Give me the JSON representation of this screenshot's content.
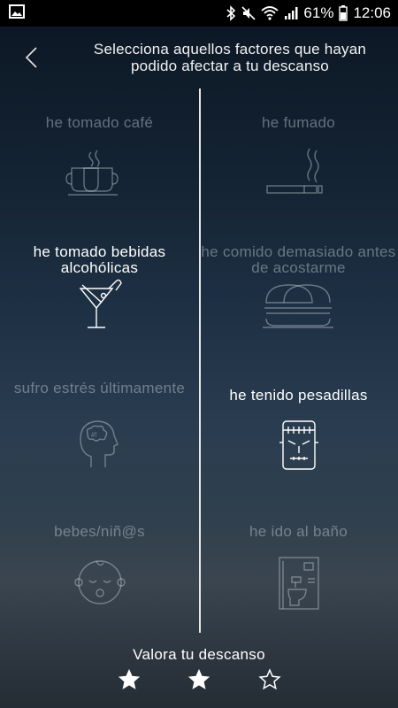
{
  "status_bar": {
    "battery": "61%",
    "time": "12:06",
    "icons": [
      "image-icon",
      "bluetooth-icon",
      "mute-icon",
      "wifi-icon",
      "signal-icon",
      "battery-icon"
    ]
  },
  "header": {
    "title": "Selecciona aquellos factores que hayan podido afectar a tu descanso"
  },
  "factors": [
    {
      "label": "he tomado café",
      "icon": "coffee-icon",
      "selected": false
    },
    {
      "label": "he fumado",
      "icon": "cigarette-icon",
      "selected": false
    },
    {
      "label": "he tomado bebidas alcohólicas",
      "icon": "cocktail-icon",
      "selected": true
    },
    {
      "label": "he comido demasiado antes de acostarme",
      "icon": "burger-icon",
      "selected": false
    },
    {
      "label": "sufro estrés últimamente",
      "icon": "stressed-head-icon",
      "selected": false
    },
    {
      "label": "he tenido pesadillas",
      "icon": "frankenstein-icon",
      "selected": true
    },
    {
      "label": "bebes/niñ@s",
      "icon": "baby-icon",
      "selected": false
    },
    {
      "label": "he ido al baño",
      "icon": "toilet-icon",
      "selected": false
    }
  ],
  "rating": {
    "title": "Valora tu descanso",
    "value": 2,
    "max": 3
  },
  "colors": {
    "active": "#ffffff",
    "inactive": "#8a96a3"
  }
}
